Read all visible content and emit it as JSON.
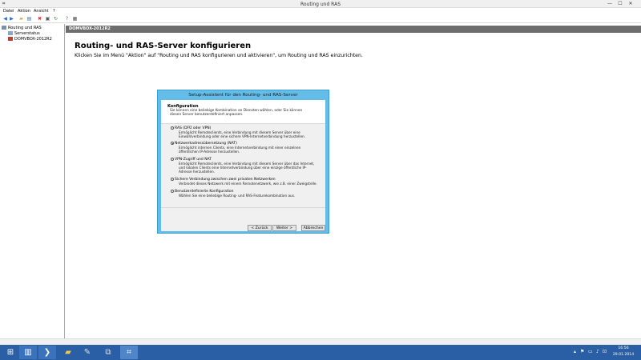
{
  "window": {
    "title": "Routing und RAS",
    "app_icon": "routing-icon",
    "minimize": "—",
    "maximize": "☐",
    "close": "✕"
  },
  "menu": [
    "Datei",
    "Aktion",
    "Ansicht",
    "?"
  ],
  "toolbar_icons": [
    "back-icon",
    "forward-icon",
    "folder-up-icon",
    "show-hide-tree-icon",
    "delete-icon",
    "properties-icon",
    "refresh-icon",
    "export-icon",
    "help-icon",
    "view-icon"
  ],
  "tree": [
    {
      "label": "Routing und RAS",
      "icon": "routing-icon"
    },
    {
      "label": "Serverstatus",
      "icon": "server-status-icon"
    },
    {
      "label": "DOMVBOX-2012R2",
      "icon": "server-icon"
    }
  ],
  "main": {
    "header": "DOMVBOX-2012R2",
    "title": "Routing- und RAS-Server konfigurieren",
    "description": "Klicken Sie im Menü \"Aktion\" auf \"Routing und RAS konfigurieren und aktivieren\", um Routing und RAS einzurichten."
  },
  "wizard": {
    "title": "Setup-Assistent für den Routing- und RAS-Server",
    "heading": "Konfiguration",
    "subheading": "Sie können eine beliebige Kombination an Diensten wählen, oder Sie können diesen Server benutzerdefiniert anpassen.",
    "options": [
      {
        "label": "RAS (DFÜ oder VPN)",
        "selected": false,
        "description": "Ermöglicht Remoteclients, eine Verbindung mit diesem Server über eine Einwählverbindung oder eine sichere VPN-Internetverbindung herzustellen."
      },
      {
        "label": "Netzwerkadressübersetzung (NAT)",
        "selected": true,
        "description": "Ermöglicht internen Clients, eine Internetverbindung mit einer einzelnen öffentlichen IP-Adresse herzustellen."
      },
      {
        "label": "VPN-Zugriff und NAT",
        "selected": false,
        "description": "Ermöglicht Remoteclients, eine Verbindung mit diesem Server über das Internet, und lokalen Clients eine Internetverbindung über eine einzige öffentliche IP-Adresse herzustellen."
      },
      {
        "label": "Sichere Verbindung zwischen zwei privaten Netzwerken",
        "selected": false,
        "description": "Verbindet dieses Netzwerk mit einem Remotenetzwerk, wie z.B. einer Zweigstelle."
      },
      {
        "label": "Benutzerdefinierte Konfiguration",
        "selected": false,
        "description": "Wählen Sie eine beliebige Routing- und RAS-Featurekombination aus."
      }
    ],
    "buttons": {
      "back": "< Zurück",
      "next": "Weiter >",
      "cancel": "Abbrechen"
    }
  },
  "taskbar": {
    "items": [
      "start-icon",
      "server-manager-icon",
      "powershell-icon",
      "explorer-icon",
      "tools-icon",
      "network-icon",
      "routing-icon"
    ],
    "time": "16:56",
    "date": "29.01.2014"
  }
}
